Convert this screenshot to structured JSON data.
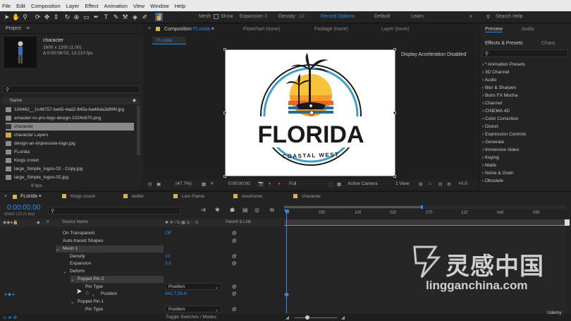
{
  "menu": [
    "File",
    "Edit",
    "Composition",
    "Layer",
    "Effect",
    "Animation",
    "View",
    "Window",
    "Help"
  ],
  "toolbar": {
    "mesh_label": "Mesh",
    "show_label": "Show",
    "expansion_label": "Expansion:",
    "expansion_value": "3",
    "density_label": "Density:",
    "density_value": "10",
    "record_options": "Record Options",
    "workspace_default": "Default",
    "workspace_learn": "Learn",
    "search_help": "Search Help"
  },
  "project": {
    "title": "Project",
    "selected_name": "character",
    "selected_dims": "1600 x 1200 (1.00)",
    "selected_duration": "Δ 0:00:08:02, 13.210 fps",
    "col_name": "Name",
    "items": [
      "109462__1c46757-beb5-4ad2-845a-ba46da3d9f4f.jpg",
      "amauter-vs-pro-logo-design-1024x670.png",
      "character",
      "character Layers",
      "design-an-impressive-logo.jpg",
      "FLorida",
      "Kings crown",
      "large_Simple_logos-02 - Copy.jpg",
      "large_Simple_logos-02.jpg"
    ],
    "bpc": "8 bpc"
  },
  "composition": {
    "tab_label": "Composition",
    "tab_name": "FLorida",
    "flowchart": "Flowchart (none)",
    "footage": "Footage (none)",
    "layer": "Layer (none)",
    "subtab": "FLorida",
    "display_message": "Display Acceleration Disabled",
    "logo_main": "FLORIDA",
    "logo_sub": "COASTAL WEST",
    "zoom": "(47.7%)",
    "timecode": "0:00:00:00",
    "resolution": "Full",
    "camera": "Active Camera",
    "views": "1 View",
    "offset": "+0.0"
  },
  "effects": {
    "preview_tab": "Preview",
    "audio_tab": "Audio",
    "effects_tab": "Effects & Presets",
    "char_tab": "Chara",
    "items": [
      "* Animation Presets",
      "3D Channel",
      "Audio",
      "Blur & Sharpen",
      "Boris FX Mocha",
      "Channel",
      "CINEMA 4D",
      "Color Correction",
      "Distort",
      "Expression Controls",
      "Generate",
      "Immersive Video",
      "Keying",
      "Matte",
      "Noise & Grain",
      "Obsolete"
    ]
  },
  "timeline": {
    "tabs": [
      "FLorida",
      "Kings crown",
      "twitter",
      "Lion Flame",
      "wisehome",
      "character"
    ],
    "timecode": "0:00:00:00",
    "frames": "00000 (13.21 fps)",
    "col_source": "Source Name",
    "col_parent": "Parent & Link",
    "ruler": [
      "0f",
      "05f",
      "10f",
      "02f",
      "07f",
      "12f",
      "04f",
      "09f"
    ],
    "props": [
      {
        "name": "On Transparent",
        "value": "Off"
      },
      {
        "name": "Auto-traced Shapes",
        "value": ""
      },
      {
        "name": "Mesh 1",
        "value": ""
      },
      {
        "name": "Density",
        "value": "10"
      },
      {
        "name": "Expansion",
        "value": "3.0"
      },
      {
        "name": "Deform",
        "value": ""
      },
      {
        "name": "Puppet Pin 2",
        "value": ""
      },
      {
        "name": "Pin Type",
        "value": "Position"
      },
      {
        "name": "Position",
        "value": "442.7,98.6"
      },
      {
        "name": "Puppet Pin 1",
        "value": ""
      },
      {
        "name": "Pin Type",
        "value": "Position"
      }
    ],
    "toggle_label": "Toggle Switches / Modes"
  },
  "watermark": {
    "chinese": "灵感中国",
    "latin": "lingganchina.com",
    "udemy": "Udemy"
  },
  "colors": {
    "accent": "#2d8ceb",
    "label_yellow": "#d8b25a",
    "timeline_green": "#3fbf3f"
  }
}
